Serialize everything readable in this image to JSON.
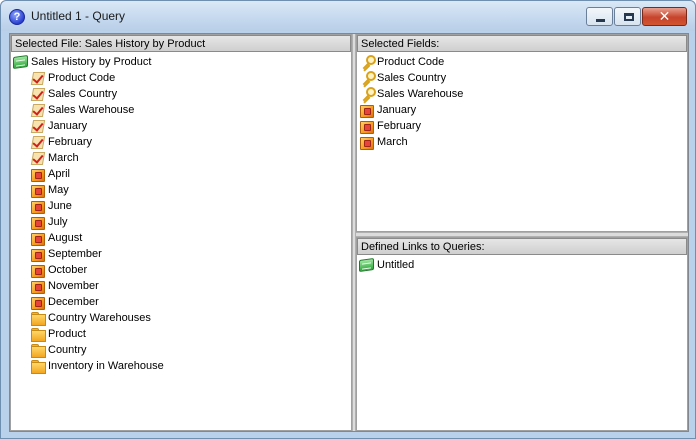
{
  "window": {
    "title": "Untitled 1 - Query",
    "controls": {
      "minimize": "minimize",
      "maximize": "maximize",
      "close": "✕"
    }
  },
  "selected_file": {
    "header": "Selected File: Sales History by Product",
    "root": {
      "label": "Sales History by Product",
      "icon": "table-icon"
    },
    "items": [
      {
        "label": "Product Code",
        "icon": "checked-field-icon"
      },
      {
        "label": "Sales Country",
        "icon": "checked-field-icon"
      },
      {
        "label": "Sales Warehouse",
        "icon": "checked-field-icon"
      },
      {
        "label": "January",
        "icon": "checked-field-icon"
      },
      {
        "label": "February",
        "icon": "checked-field-icon"
      },
      {
        "label": "March",
        "icon": "checked-field-icon"
      },
      {
        "label": "April",
        "icon": "cube-icon"
      },
      {
        "label": "May",
        "icon": "cube-icon"
      },
      {
        "label": "June",
        "icon": "cube-icon"
      },
      {
        "label": "July",
        "icon": "cube-icon"
      },
      {
        "label": "August",
        "icon": "cube-icon"
      },
      {
        "label": "September",
        "icon": "cube-icon"
      },
      {
        "label": "October",
        "icon": "cube-icon"
      },
      {
        "label": "November",
        "icon": "cube-icon"
      },
      {
        "label": "December",
        "icon": "cube-icon"
      },
      {
        "label": "Country Warehouses",
        "icon": "folder-icon"
      },
      {
        "label": "Product",
        "icon": "folder-icon"
      },
      {
        "label": "Country",
        "icon": "folder-icon"
      },
      {
        "label": "Inventory in Warehouse",
        "icon": "folder-icon"
      }
    ]
  },
  "selected_fields": {
    "header": "Selected Fields:",
    "items": [
      {
        "label": "Product Code",
        "icon": "key-icon"
      },
      {
        "label": "Sales Country",
        "icon": "key-icon"
      },
      {
        "label": "Sales Warehouse",
        "icon": "key-icon"
      },
      {
        "label": "January",
        "icon": "cube-icon"
      },
      {
        "label": "February",
        "icon": "cube-icon"
      },
      {
        "label": "March",
        "icon": "cube-icon"
      }
    ]
  },
  "defined_links": {
    "header": "Defined Links to Queries:",
    "items": [
      {
        "label": "Untitled",
        "icon": "table-icon"
      }
    ]
  }
}
